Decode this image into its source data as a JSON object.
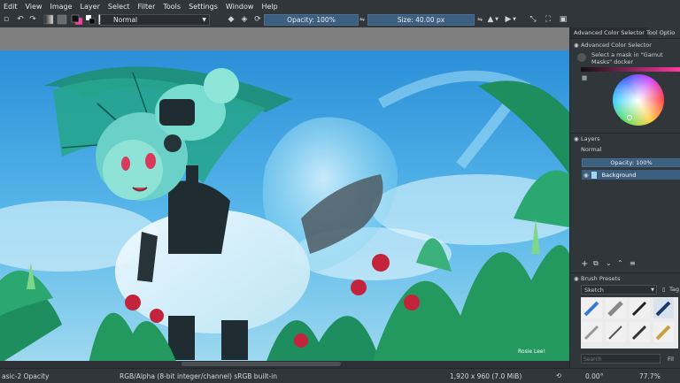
{
  "menu": [
    "Edit",
    "View",
    "Image",
    "Layer",
    "Select",
    "Filter",
    "Tools",
    "Settings",
    "Window",
    "Help"
  ],
  "toolbar": {
    "blend_mode": "Normal",
    "opacity_label": "Opacity: 100%",
    "size_label": "Size: 40.00 px"
  },
  "dock": {
    "tabs": [
      "Advanced Color Selector",
      "Tool Optio"
    ],
    "color_selector_title": "Advanced Color Selector",
    "mask_hint": "Select a mask in \"Gamut Masks\" docker",
    "layers_title": "Layers",
    "layer_blend": "Normal",
    "layer_opacity": "Opacity: 100%",
    "layer_name": "Background",
    "brush_presets_title": "Brush Presets",
    "brush_tag": "Sketch",
    "tag_button": "Tag",
    "search_placeholder": "Search",
    "filter_button": "Fil"
  },
  "status": {
    "brush_name": "asic-2 Opacity",
    "color_space": "RGB/Alpha (8-bit integer/channel)  sRGB built-in",
    "image_size": "1,920 x 960 (7.0 MiB)",
    "rotation": "0.00°",
    "zoom": "77.7%"
  },
  "artwork": {
    "signature": "Rosie Lee!"
  },
  "colors": {
    "ui_bg": "#31363b",
    "accent": "#3d5f7f",
    "canvas_bg": "#7f7f7f"
  }
}
